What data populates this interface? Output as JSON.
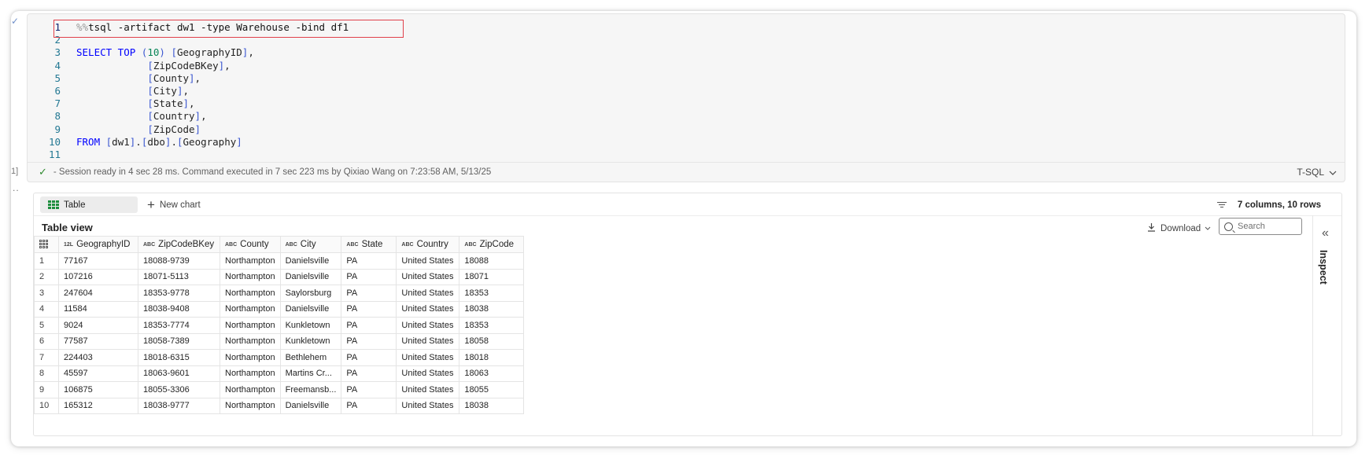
{
  "code_cell": {
    "lines": [
      {
        "n": "1",
        "html": "<span class=\"mag\">%%</span><span class=\"ident\">tsql -artifact dw1 -type Warehouse -bind df1</span>"
      },
      {
        "n": "2",
        "html": ""
      },
      {
        "n": "3",
        "html": "<span class=\"kw\">SELECT TOP</span> <span class=\"br\">(</span><span class=\"lit\">10</span><span class=\"br\">)</span> <span class=\"br\">[</span>GeographyID<span class=\"br\">]</span>,"
      },
      {
        "n": "4",
        "html": "            <span class=\"br\">[</span>ZipCodeBKey<span class=\"br\">]</span>,"
      },
      {
        "n": "5",
        "html": "            <span class=\"br\">[</span>County<span class=\"br\">]</span>,"
      },
      {
        "n": "6",
        "html": "            <span class=\"br\">[</span>City<span class=\"br\">]</span>,"
      },
      {
        "n": "7",
        "html": "            <span class=\"br\">[</span>State<span class=\"br\">]</span>,"
      },
      {
        "n": "8",
        "html": "            <span class=\"br\">[</span>Country<span class=\"br\">]</span>,"
      },
      {
        "n": "9",
        "html": "            <span class=\"br\">[</span>ZipCode<span class=\"br\">]</span>"
      },
      {
        "n": "10",
        "html": "<span class=\"kw\">FROM</span> <span class=\"br\">[</span>dw1<span class=\"br\">]</span>.<span class=\"br\">[</span>dbo<span class=\"br\">]</span>.<span class=\"br\">[</span>Geography<span class=\"br\">]</span>"
      },
      {
        "n": "11",
        "html": ""
      }
    ],
    "status_text": "- Session ready in 4 sec 28 ms. Command executed in 7 sec 223 ms by Qixiao Wang on 7:23:58 AM, 5/13/25",
    "language": "T-SQL"
  },
  "gutter": {
    "check": "✓",
    "exec_count": "1]",
    "more": ".."
  },
  "output": {
    "tab_table": "Table",
    "new_chart": "New chart",
    "summary": "7 columns, 10 rows",
    "view_title": "Table view",
    "download": "Download",
    "search_placeholder": "Search",
    "inspect": "Inspect",
    "columns": [
      {
        "type": "12L",
        "name": "GeographyID"
      },
      {
        "type": "ABC",
        "name": "ZipCodeBKey"
      },
      {
        "type": "ABC",
        "name": "County"
      },
      {
        "type": "ABC",
        "name": "City"
      },
      {
        "type": "ABC",
        "name": "State"
      },
      {
        "type": "ABC",
        "name": "Country"
      },
      {
        "type": "ABC",
        "name": "ZipCode"
      }
    ],
    "rows": [
      [
        "1",
        "77167",
        "18088-9739",
        "Northampton",
        "Danielsville",
        "PA",
        "United States",
        "18088"
      ],
      [
        "2",
        "107216",
        "18071-5113",
        "Northampton",
        "Danielsville",
        "PA",
        "United States",
        "18071"
      ],
      [
        "3",
        "247604",
        "18353-9778",
        "Northampton",
        "Saylorsburg",
        "PA",
        "United States",
        "18353"
      ],
      [
        "4",
        "11584",
        "18038-9408",
        "Northampton",
        "Danielsville",
        "PA",
        "United States",
        "18038"
      ],
      [
        "5",
        "9024",
        "18353-7774",
        "Northampton",
        "Kunkletown",
        "PA",
        "United States",
        "18353"
      ],
      [
        "6",
        "77587",
        "18058-7389",
        "Northampton",
        "Kunkletown",
        "PA",
        "United States",
        "18058"
      ],
      [
        "7",
        "224403",
        "18018-6315",
        "Northampton",
        "Bethlehem",
        "PA",
        "United States",
        "18018"
      ],
      [
        "8",
        "45597",
        "18063-9601",
        "Northampton",
        "Martins Cr...",
        "PA",
        "United States",
        "18063"
      ],
      [
        "9",
        "106875",
        "18055-3306",
        "Northampton",
        "Freemansb...",
        "PA",
        "United States",
        "18055"
      ],
      [
        "10",
        "165312",
        "18038-9777",
        "Northampton",
        "Danielsville",
        "PA",
        "United States",
        "18038"
      ]
    ]
  }
}
